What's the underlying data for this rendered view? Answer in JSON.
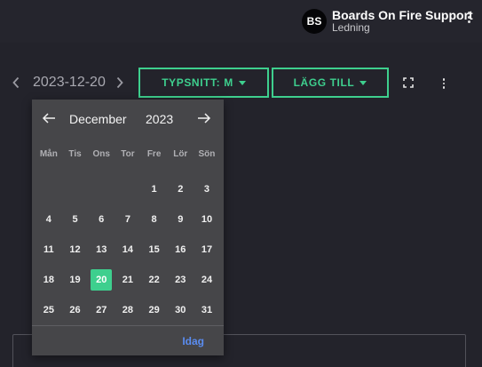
{
  "header": {
    "avatar_initials": "BS",
    "org_name": "Boards On Fire Support",
    "org_role": "Ledning"
  },
  "toolbar": {
    "date": "2023-12-20",
    "font_button_label": "TYPSNITT: M",
    "add_button_label": "LÄGG TILL"
  },
  "datepicker": {
    "month": "December",
    "year": "2023",
    "weekdays": [
      "Mån",
      "Tis",
      "Ons",
      "Tor",
      "Fre",
      "Lör",
      "Sön"
    ],
    "weeks": [
      [
        "",
        "",
        "",
        "",
        "1",
        "2",
        "3"
      ],
      [
        "4",
        "5",
        "6",
        "7",
        "8",
        "9",
        "10"
      ],
      [
        "11",
        "12",
        "13",
        "14",
        "15",
        "16",
        "17"
      ],
      [
        "18",
        "19",
        "20",
        "21",
        "22",
        "23",
        "24"
      ],
      [
        "25",
        "26",
        "27",
        "28",
        "29",
        "30",
        "31"
      ]
    ],
    "selected_day": "20",
    "today_label": "Idag"
  },
  "colors": {
    "accent": "#3ecf8e",
    "link": "#5a8cf0",
    "background": "#23232b",
    "popup": "#464649"
  },
  "icons": {
    "prev_date": "chevron-left-icon",
    "next_date": "chevron-right-icon",
    "fullscreen": "fullscreen-icon",
    "more": "more-vertical-icon",
    "prev_month": "arrow-left-icon",
    "next_month": "arrow-right-icon"
  }
}
